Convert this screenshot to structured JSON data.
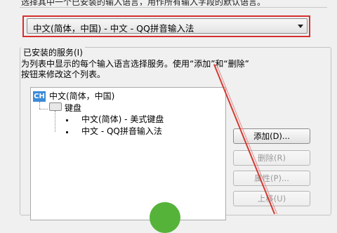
{
  "top_text": "选择其中一个已安装的输入语言，用作所有输入字段的默认语言。",
  "default_language": {
    "selected": "中文(简体，中国) - 中文 - QQ拼音输入法"
  },
  "installed_services": {
    "title": "已安装的服务(I)",
    "description_line1": "为列表中显示的每个输入语言选择服务。使用“添加”和“删除”",
    "description_line2": "按钮来修改这个列表。"
  },
  "tree": {
    "language_badge": "CH",
    "language": "中文(简体，中国)",
    "keyboard_group": "键盘",
    "items": [
      "中文(简体) - 美式键盘",
      "中文 - QQ拼音输入法"
    ]
  },
  "buttons": {
    "add": "添加(D)...",
    "remove": "删除(R)",
    "properties": "属性(P)...",
    "move_up": "上移(U)"
  },
  "colors": {
    "highlight": "#d5302f",
    "badge": "#3b8ad8",
    "circle": "#55b33a"
  }
}
